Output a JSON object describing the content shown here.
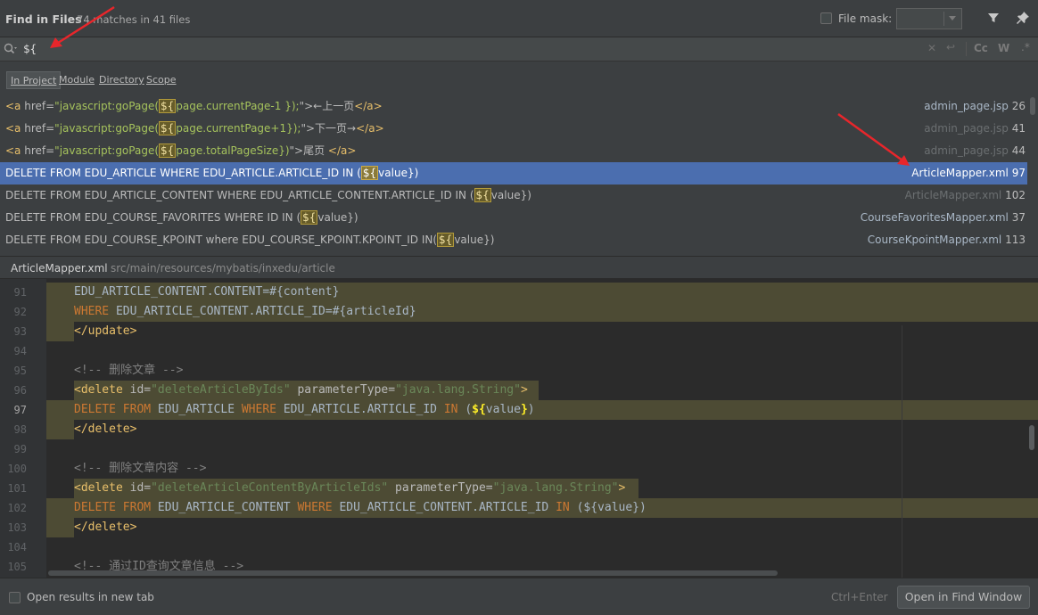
{
  "header": {
    "title": "Find in Files",
    "matches": "74 matches in 41 files",
    "file_mask_label": "File mask:"
  },
  "search": {
    "query": "${"
  },
  "scopes": [
    "In Project",
    "Module",
    "Directory",
    "Scope"
  ],
  "results": [
    {
      "parts": [
        {
          "c": "tg",
          "t": "<a "
        },
        {
          "c": "",
          "t": "href="
        },
        {
          "c": "av",
          "t": "\"javascript:goPage("
        },
        {
          "c": "hl",
          "t": "${"
        },
        {
          "c": "av",
          "t": "page.currentPage-1 });"
        },
        {
          "c": "",
          "t": "\">←上一页"
        },
        {
          "c": "tg",
          "t": "</a>"
        }
      ],
      "file": "admin_page.jsp",
      "line": "26",
      "dim": false
    },
    {
      "parts": [
        {
          "c": "tg",
          "t": "<a "
        },
        {
          "c": "",
          "t": "href="
        },
        {
          "c": "av",
          "t": "\"javascript:goPage("
        },
        {
          "c": "hl",
          "t": "${"
        },
        {
          "c": "av",
          "t": "page.currentPage+1});"
        },
        {
          "c": "",
          "t": "\">下一页→"
        },
        {
          "c": "tg",
          "t": "</a>"
        }
      ],
      "file": "admin_page.jsp",
      "line": "41",
      "dim": true
    },
    {
      "parts": [
        {
          "c": "tg",
          "t": "<a "
        },
        {
          "c": "",
          "t": "href="
        },
        {
          "c": "av",
          "t": "\"javascript:goPage("
        },
        {
          "c": "hl",
          "t": "${"
        },
        {
          "c": "av",
          "t": "page.totalPageSize})"
        },
        {
          "c": "",
          "t": "\">尾页 "
        },
        {
          "c": "tg",
          "t": "</a>"
        }
      ],
      "file": "admin_page.jsp",
      "line": "44",
      "dim": true
    },
    {
      "parts": [
        {
          "c": "",
          "t": "DELETE FROM EDU_ARTICLE WHERE EDU_ARTICLE.ARTICLE_ID IN ("
        },
        {
          "c": "hl",
          "t": "${"
        },
        {
          "c": "",
          "t": "value})"
        }
      ],
      "file": "ArticleMapper.xml",
      "line": "97",
      "dim": false,
      "selected": true
    },
    {
      "parts": [
        {
          "c": "",
          "t": "DELETE FROM EDU_ARTICLE_CONTENT WHERE EDU_ARTICLE_CONTENT.ARTICLE_ID IN ("
        },
        {
          "c": "hl",
          "t": "${"
        },
        {
          "c": "",
          "t": "value})"
        }
      ],
      "file": "ArticleMapper.xml",
      "line": "102",
      "dim": true
    },
    {
      "parts": [
        {
          "c": "",
          "t": "DELETE FROM EDU_COURSE_FAVORITES WHERE ID  IN  ("
        },
        {
          "c": "hl",
          "t": "${"
        },
        {
          "c": "",
          "t": "value})"
        }
      ],
      "file": "CourseFavoritesMapper.xml",
      "line": "37",
      "dim": false
    },
    {
      "parts": [
        {
          "c": "",
          "t": "DELETE FROM EDU_COURSE_KPOINT where EDU_COURSE_KPOINT.KPOINT_ID IN("
        },
        {
          "c": "hl",
          "t": "${"
        },
        {
          "c": "",
          "t": "value})"
        }
      ],
      "file": "CourseKpointMapper.xml",
      "line": "113",
      "dim": false
    }
  ],
  "preview": {
    "file": "ArticleMapper.xml",
    "path": "src/main/resources/mybatis/inxedu/article"
  },
  "code_lines": [
    {
      "n": "91",
      "band": [
        52,
        1164
      ],
      "parts": [
        {
          "c": "",
          "t": "EDU_ARTICLE_CONTENT.CONTENT=#{content}"
        }
      ]
    },
    {
      "n": "92",
      "band": [
        52,
        1164
      ],
      "parts": [
        {
          "c": "c-kw",
          "t": "WHERE "
        },
        {
          "c": "",
          "t": "EDU_ARTICLE_CONTENT.ARTICLE_ID=#{articleId}"
        }
      ]
    },
    {
      "n": "93",
      "band": [
        52,
        83
      ],
      "parts": [
        {
          "c": "c-tag",
          "t": "</update>"
        }
      ]
    },
    {
      "n": "94",
      "parts": []
    },
    {
      "n": "95",
      "parts": [
        {
          "c": "c-com",
          "t": "<!-- 删除文章 -->"
        }
      ]
    },
    {
      "n": "96",
      "band": [
        83,
        604
      ],
      "parts": [
        {
          "c": "c-tag",
          "t": "<delete "
        },
        {
          "c": "c-attr",
          "t": "id="
        },
        {
          "c": "c-val",
          "t": "\"deleteArticleByIds\" "
        },
        {
          "c": "c-attr",
          "t": "parameterType="
        },
        {
          "c": "c-val",
          "t": "\"java.lang.String\""
        },
        {
          "c": "c-tag",
          "t": ">"
        }
      ]
    },
    {
      "n": "97",
      "band": [
        52,
        1164
      ],
      "cur": true,
      "parts": [
        {
          "c": "c-kw",
          "t": "DELETE FROM "
        },
        {
          "c": "",
          "t": "EDU_ARTICLE "
        },
        {
          "c": "c-kw",
          "t": "WHERE "
        },
        {
          "c": "",
          "t": "EDU_ARTICLE.ARTICLE_ID "
        },
        {
          "c": "c-kw",
          "t": "IN "
        },
        {
          "c": "",
          "t": "("
        },
        {
          "c": "c-mhl",
          "t": "${"
        },
        {
          "c": "",
          "t": "value"
        },
        {
          "c": "c-mhl",
          "t": "}"
        },
        {
          "c": "",
          "t": ")"
        }
      ]
    },
    {
      "n": "98",
      "band": [
        52,
        83
      ],
      "parts": [
        {
          "c": "c-tag",
          "t": "</delete>"
        }
      ]
    },
    {
      "n": "99",
      "parts": []
    },
    {
      "n": "100",
      "parts": [
        {
          "c": "c-com",
          "t": "<!-- 删除文章内容 -->"
        }
      ]
    },
    {
      "n": "101",
      "band": [
        83,
        716
      ],
      "parts": [
        {
          "c": "c-tag",
          "t": "<delete "
        },
        {
          "c": "c-attr",
          "t": "id="
        },
        {
          "c": "c-val",
          "t": "\"deleteArticleContentByArticleIds\" "
        },
        {
          "c": "c-attr",
          "t": "parameterType="
        },
        {
          "c": "c-val",
          "t": "\"java.lang.String\""
        },
        {
          "c": "c-tag",
          "t": ">"
        }
      ]
    },
    {
      "n": "102",
      "band": [
        52,
        1164
      ],
      "parts": [
        {
          "c": "c-kw",
          "t": "DELETE FROM "
        },
        {
          "c": "",
          "t": "EDU_ARTICLE_CONTENT "
        },
        {
          "c": "c-kw",
          "t": "WHERE "
        },
        {
          "c": "",
          "t": "EDU_ARTICLE_CONTENT.ARTICLE_ID "
        },
        {
          "c": "c-kw",
          "t": "IN "
        },
        {
          "c": "",
          "t": "(${value})"
        }
      ]
    },
    {
      "n": "103",
      "band": [
        52,
        83
      ],
      "parts": [
        {
          "c": "c-tag",
          "t": "</delete>"
        }
      ]
    },
    {
      "n": "104",
      "parts": []
    },
    {
      "n": "105",
      "parts": [
        {
          "c": "c-com",
          "t": "<!-- 通过ID查询文章信息 -->"
        }
      ]
    }
  ],
  "footer": {
    "open_new_tab_label": "Open results in new tab",
    "shortcut": "Ctrl+Enter",
    "open_find_window_label": "Open in Find Window"
  },
  "icons": {
    "search": "search-icon",
    "filter": "funnel-icon",
    "pin": "pin-icon",
    "annotation": "red-arrow"
  },
  "colors": {
    "background": "#3c3f41",
    "selection": "#4b6eaf",
    "match_highlight": "#665c2a",
    "annotation_arrow": "#e8262b"
  }
}
